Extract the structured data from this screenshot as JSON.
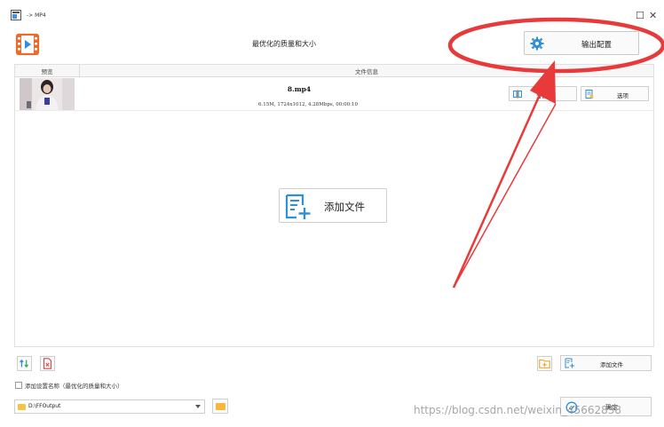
{
  "window": {
    "title": "-> MP4",
    "close_glyph": "✕",
    "restore_glyph": "☐"
  },
  "header": {
    "logo_icon": "video-format-icon",
    "quality_title": "最优化的质量和大小",
    "output_config_label": "输出配置",
    "output_config_icon": "gear-icon"
  },
  "file_list": {
    "columns": [
      "预览",
      "文件信息"
    ],
    "items": [
      {
        "name": "8.mp4",
        "meta": "6.15M, 1724x1012, 4.28Mbps, 00:00:10",
        "split_label": "分割",
        "options_label": "选项"
      }
    ]
  },
  "center": {
    "add_file_label": "添加文件"
  },
  "footer": {
    "add_file_label": "添加文件",
    "save_setting_label": "添加设置名称（最优化的质量和大小）",
    "save_setting_checked": false,
    "output_path": "D:\\FFOutput",
    "confirm_label": "确定"
  },
  "watermark": {
    "text": "https://blog.csdn.net/weixin_45662838"
  },
  "colors": {
    "accent_blue": "#2f8fd8",
    "annotation_red": "#e83a3a",
    "folder_yellow": "#f6c343",
    "logo_orange": "#e86c2c"
  }
}
